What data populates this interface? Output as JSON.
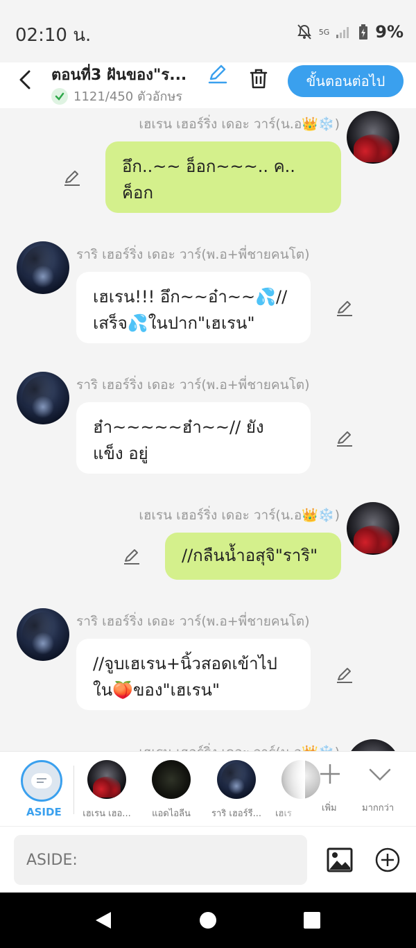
{
  "status": {
    "time": "02:10 น.",
    "network": "5G",
    "battery": "9%"
  },
  "header": {
    "title": "ตอนที่3 ฝันของ\"ร...",
    "char_count": "1121/450 ตัวอักษร",
    "next_label": "ขั้นตอนต่อไป"
  },
  "messages": [
    {
      "speaker": "เฮเรน เฮอร์ริ่ง เดอะ วาร์(น.อ👑❄️)",
      "side": "right",
      "text": "อึก..~~ อ็อก~~~.. ค.. ค็อก"
    },
    {
      "speaker": "ราริ เฮอร์ริ่ง เดอะ วาร์(พ.อ+พี่ชายคนโต)",
      "side": "left",
      "text": "เฮเรน!!! อึก~~อ๋า~~💦// เสร็จ💦ในปาก\"เฮเรน\""
    },
    {
      "speaker": "ราริ เฮอร์ริ่ง เดอะ วาร์(พ.อ+พี่ชายคนโต)",
      "side": "left",
      "text": "ฮ๋า~~~~~ฮ๋า~~// ยังแข็ง อยู่"
    },
    {
      "speaker": "เฮเรน เฮอร์ริ่ง เดอะ วาร์(น.อ👑❄️)",
      "side": "right",
      "text": "//กลืนน้ำอสุจิ\"ราริ\""
    },
    {
      "speaker": "ราริ เฮอร์ริ่ง เดอะ วาร์(พ.อ+พี่ชายคนโต)",
      "side": "left",
      "text": "//จูบเฮเรน+นิ้วสอดเข้าไป ใน🍑ของ\"เฮเรน\""
    },
    {
      "speaker": "เฮเรน เฮอร์ริ่ง เดอะ วาร์(น.อ👑❄️)",
      "side": "right",
      "text": ""
    }
  ],
  "characters": {
    "aside_label": "ASIDE",
    "items": [
      {
        "label": "เฮเรน เฮอ...",
        "avatar": "red-hood-avatar"
      },
      {
        "label": "แอดไอลีน",
        "avatar": "dark-avatar"
      },
      {
        "label": "ราริ เฮอร์รี...",
        "avatar": "blue-avatar"
      },
      {
        "label": "เฮเร",
        "avatar": "white-avatar"
      }
    ],
    "add_label": "เพิ่ม",
    "more_label": "มากกว่า"
  },
  "composer": {
    "placeholder": "ASIDE:"
  },
  "colors": {
    "accent": "#3aa0ee",
    "bubble_self": "#d4f08c",
    "bubble_other": "#ffffff"
  }
}
